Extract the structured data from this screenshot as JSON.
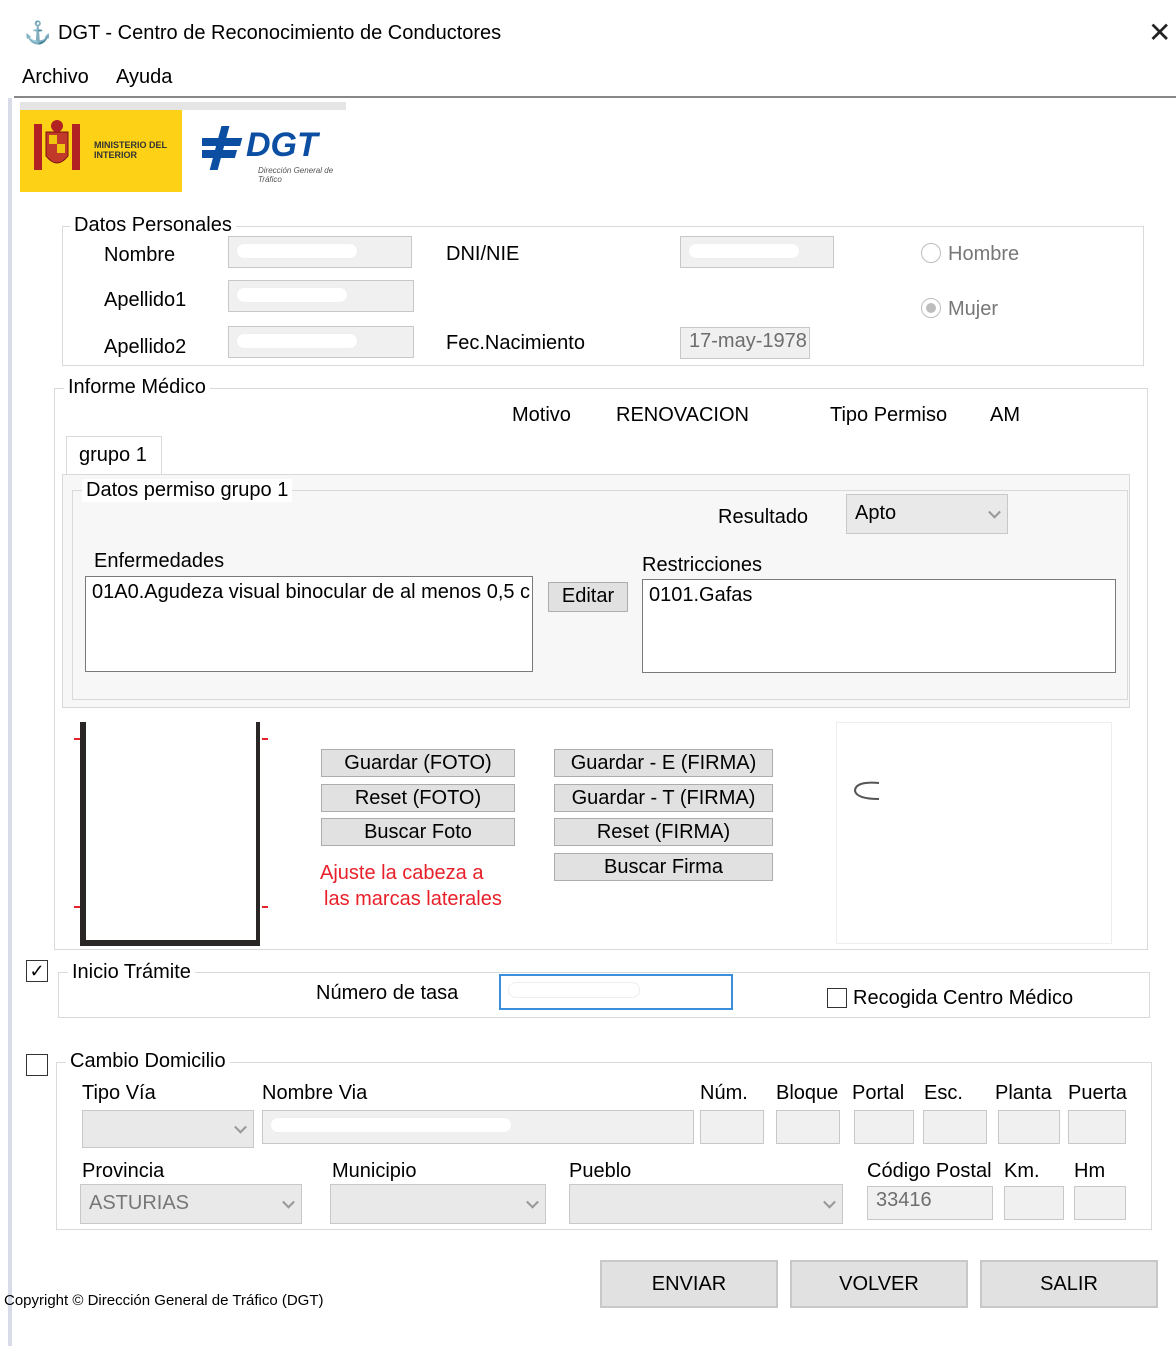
{
  "window": {
    "title": "DGT - Centro de Reconocimiento de Conductores",
    "close_icon": "close-icon"
  },
  "menu": {
    "items": [
      "Archivo",
      "Ayuda"
    ]
  },
  "logos": {
    "ministerio": "MINISTERIO DEL INTERIOR",
    "dgt": "DGT",
    "dgt_sub": "Dirección General de Tráfico"
  },
  "personal": {
    "legend": "Datos Personales",
    "nombre_label": "Nombre",
    "apellido1_label": "Apellido1",
    "apellido2_label": "Apellido2",
    "dni_label": "DNI/NIE",
    "fec_label": "Fec.Nacimiento",
    "fec_value": "17-may-1978",
    "hombre_label": "Hombre",
    "mujer_label": "Mujer",
    "selected_gender": "Mujer"
  },
  "informe": {
    "legend": "Informe Médico",
    "motivo_label": "Motivo",
    "motivo_value": "RENOVACION",
    "tipo_label": "Tipo Permiso",
    "tipo_value": "AM",
    "tab": "grupo 1",
    "datos_legend": "Datos permiso grupo 1",
    "resultado_label": "Resultado",
    "resultado_value": "Apto",
    "enfermedades_label": "Enfermedades",
    "enfermedades_value": "01A0.Agudeza visual binocular de al menos 0,5 c",
    "editar": "Editar",
    "restricciones_label": "Restricciones",
    "restricciones_value": "0101.Gafas"
  },
  "foto": {
    "guardar_foto": "Guardar (FOTO)",
    "reset_foto": "Reset (FOTO)",
    "buscar_foto": "Buscar Foto",
    "hint_line1": "Ajuste la cabeza a",
    "hint_line2": "las marcas laterales",
    "guardar_e": "Guardar - E (FIRMA)",
    "guardar_t": "Guardar - T (FIRMA)",
    "reset_firma": "Reset (FIRMA)",
    "buscar_firma": "Buscar Firma",
    "hint_color": "#e8202a"
  },
  "tramite": {
    "legend": "Inicio Trámite",
    "checked": true,
    "tasa_label": "Número de tasa",
    "recogida_label": "Recogida Centro Médico"
  },
  "domicilio": {
    "legend": "Cambio Domicilio",
    "checked": false,
    "tipo_via": "Tipo Vía",
    "nombre_via": "Nombre Via",
    "num": "Núm.",
    "bloque": "Bloque",
    "portal": "Portal",
    "esc": "Esc.",
    "planta": "Planta",
    "puerta": "Puerta",
    "provincia": "Provincia",
    "provincia_value": "ASTURIAS",
    "municipio": "Municipio",
    "pueblo": "Pueblo",
    "cp": "Código Postal",
    "cp_value": "33416",
    "km": "Km.",
    "hm": "Hm"
  },
  "footer": {
    "copyright": "Copyright © Dirección General de Tráfico (DGT)",
    "enviar": "ENVIAR",
    "volver": "VOLVER",
    "salir": "SALIR"
  }
}
